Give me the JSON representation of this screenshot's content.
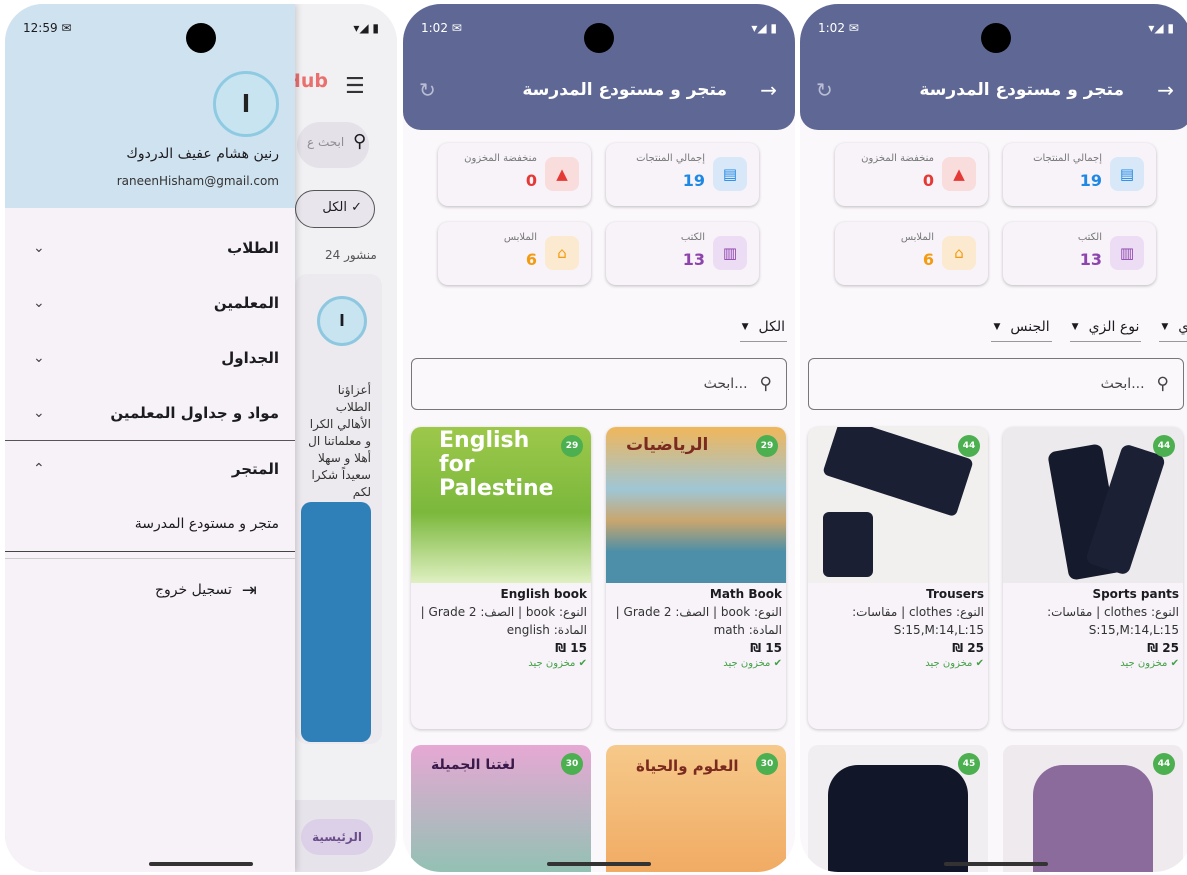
{
  "phone1": {
    "time": "12:59",
    "bg": {
      "logo": "Hub",
      "search_placeholder": "ابحث ع",
      "chip": "الكل",
      "posts_count": "منشور 24",
      "avatar_letter": "ا",
      "post_text": "أعزاؤنا الطلاب الأهالي الكرا و معلماتنا ال أهلا و سهلا سعيداً شكرا لكم",
      "home_label": "الرئيسية"
    },
    "drawer": {
      "avatar_letter": "ا",
      "user_name": "رنين هشام عفيف الدردوك",
      "email": "raneenHisham@gmail.com",
      "items": [
        {
          "label": "الطلاب"
        },
        {
          "label": "المعلمين"
        },
        {
          "label": "الجداول"
        },
        {
          "label": "مواد و جداول المعلمين"
        },
        {
          "label": "المتجر"
        }
      ],
      "sub_item": "متجر و مستودع المدرسة",
      "logout": "تسجيل خروج"
    }
  },
  "phone2": {
    "time": "1:02",
    "title": "متجر و مستودع المدرسة",
    "stats": [
      {
        "label": "إجمالي المنتجات",
        "value": "19"
      },
      {
        "label": "منخفضة المخزون",
        "value": "0"
      },
      {
        "label": "الكتب",
        "value": "13"
      },
      {
        "label": "الملابس",
        "value": "6"
      }
    ],
    "filter_all": "الكل",
    "search_placeholder": "ابحث...",
    "cards": [
      {
        "badge": "29",
        "name": "Math Book",
        "info": "النوع: book | الصف: Grade 2 | المادة: math",
        "price": "₪ 15",
        "stock": "مخزون جيد",
        "cover": "الرياضيات"
      },
      {
        "badge": "29",
        "name": "English book",
        "info": "النوع: book | الصف: Grade 2 | المادة: english",
        "price": "₪ 15",
        "stock": "مخزون جيد",
        "cover": "English for Palestine"
      },
      {
        "badge": "30",
        "cover": "العلوم والحياة"
      },
      {
        "badge": "30",
        "cover": "لغتنا الجميلة"
      }
    ]
  },
  "phone3": {
    "time": "1:02",
    "title": "متجر و مستودع المدرسة",
    "stats": [
      {
        "label": "إجمالي المنتجات",
        "value": "19"
      },
      {
        "label": "منخفضة المخزون",
        "value": "0"
      },
      {
        "label": "الكتب",
        "value": "13"
      },
      {
        "label": "الملابس",
        "value": "6"
      }
    ],
    "filters": [
      "زي",
      "نوع الزي",
      "الجنس"
    ],
    "search_placeholder": "ابحث...",
    "cards": [
      {
        "badge": "44",
        "name": "Sports pants",
        "info": "النوع: clothes | مقاسات: S:15,M:14,L:15",
        "price": "₪ 25",
        "stock": "مخزون جيد"
      },
      {
        "badge": "44",
        "name": "Trousers",
        "info": "النوع: clothes | مقاسات: S:15,M:14,L:15",
        "price": "₪ 25",
        "stock": "مخزون جيد"
      },
      {
        "badge": "44"
      },
      {
        "badge": "45"
      }
    ]
  },
  "colors": {
    "appbar": "#5f6894",
    "drawer_head": "#cfe2ef",
    "badge": "#4caf50",
    "low_stock": "#e53935",
    "total": "#1e88e5",
    "books": "#8e44ad",
    "clothes": "#f39c12"
  }
}
